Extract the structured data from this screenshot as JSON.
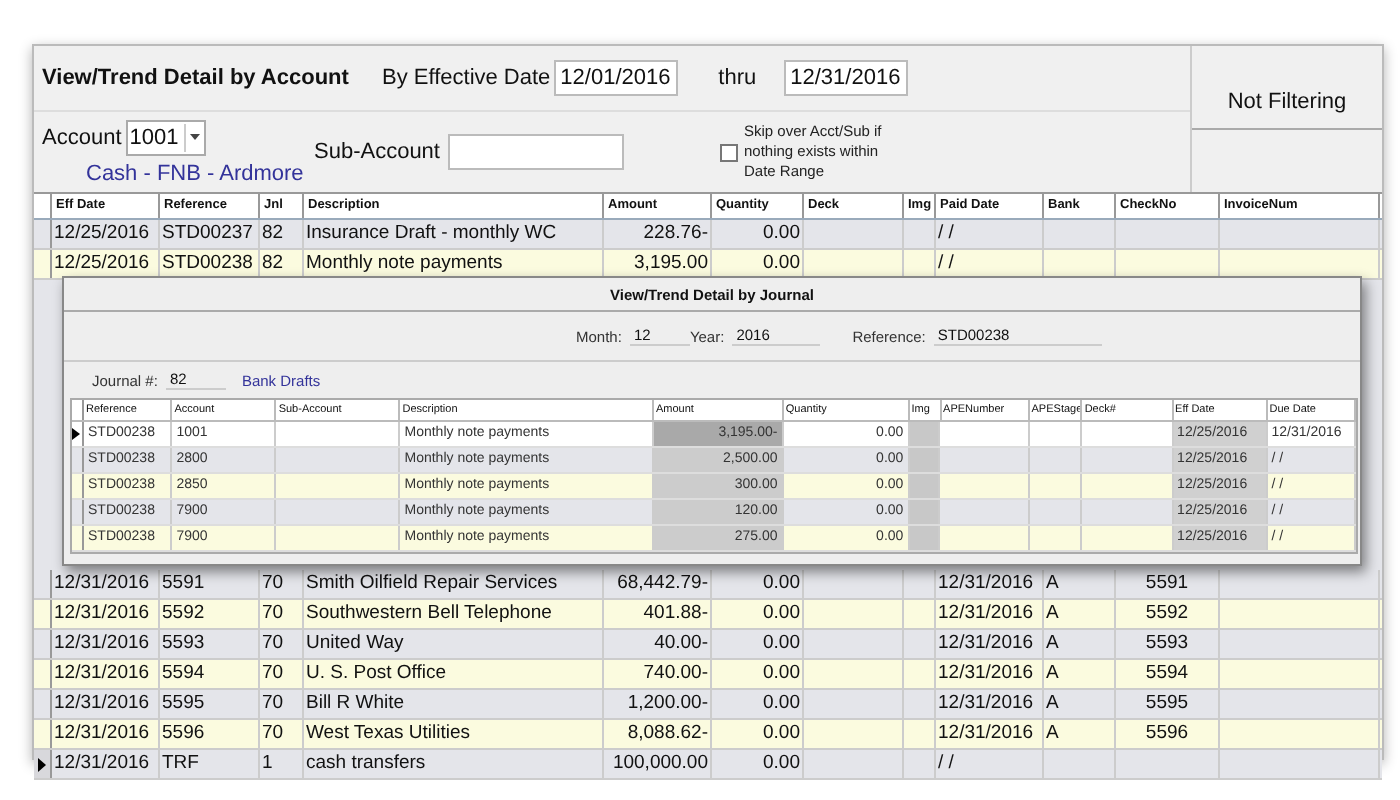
{
  "window": {
    "title": "View/Trend Detail by Account"
  },
  "filters": {
    "date_label": "By Effective Date",
    "date_from": "12/01/2016",
    "thru_label": "thru",
    "date_to": "12/31/2016",
    "account_label": "Account",
    "account": "1001",
    "account_name": "Cash - FNB - Ardmore",
    "subaccount_label": "Sub-Account",
    "skip_label": "Skip over Acct/Sub if nothing exists within Date Range",
    "skip_checked": false,
    "filter_status": "Not Filtering"
  },
  "table": {
    "columns": [
      "Eff Date",
      "Reference",
      "Jnl",
      "Description",
      "Amount",
      "Quantity",
      "Deck",
      "Img",
      "Paid Date",
      "Bank",
      "CheckNo",
      "InvoiceNum"
    ],
    "rows": [
      {
        "eff_date": "12/25/2016",
        "reference": "STD00237",
        "jnl": "82",
        "description": "Insurance Draft - monthly WC",
        "amount": "228.76-",
        "quantity": "0.00",
        "paid_date": "/ /",
        "current": false
      },
      {
        "eff_date": "12/25/2016",
        "reference": "STD00238",
        "jnl": "82",
        "description": "Monthly note payments",
        "amount": "3,195.00",
        "quantity": "0.00",
        "paid_date": "/ /",
        "current": false
      }
    ],
    "rows_below": [
      {
        "eff_date": "12/31/2016",
        "reference": "5591",
        "jnl": "70",
        "description": "Smith Oilfield Repair Services",
        "amount": "68,442.79-",
        "quantity": "0.00",
        "paid_date": "12/31/2016",
        "bank": "A",
        "checkno": "5591",
        "current": false
      },
      {
        "eff_date": "12/31/2016",
        "reference": "5592",
        "jnl": "70",
        "description": "Southwestern Bell Telephone",
        "amount": "401.88-",
        "quantity": "0.00",
        "paid_date": "12/31/2016",
        "bank": "A",
        "checkno": "5592",
        "current": false
      },
      {
        "eff_date": "12/31/2016",
        "reference": "5593",
        "jnl": "70",
        "description": "United Way",
        "amount": "40.00-",
        "quantity": "0.00",
        "paid_date": "12/31/2016",
        "bank": "A",
        "checkno": "5593",
        "current": false
      },
      {
        "eff_date": "12/31/2016",
        "reference": "5594",
        "jnl": "70",
        "description": "U. S. Post Office",
        "amount": "740.00-",
        "quantity": "0.00",
        "paid_date": "12/31/2016",
        "bank": "A",
        "checkno": "5594",
        "current": false
      },
      {
        "eff_date": "12/31/2016",
        "reference": "5595",
        "jnl": "70",
        "description": "Bill R White",
        "amount": "1,200.00-",
        "quantity": "0.00",
        "paid_date": "12/31/2016",
        "bank": "A",
        "checkno": "5595",
        "current": false
      },
      {
        "eff_date": "12/31/2016",
        "reference": "5596",
        "jnl": "70",
        "description": "West Texas Utilities",
        "amount": "8,088.62-",
        "quantity": "0.00",
        "paid_date": "12/31/2016",
        "bank": "A",
        "checkno": "5596",
        "current": false
      },
      {
        "eff_date": "12/31/2016",
        "reference": "TRF",
        "jnl": "1",
        "description": "cash transfers",
        "amount": "100,000.00",
        "quantity": "0.00",
        "paid_date": "/ /",
        "current": true
      }
    ]
  },
  "journal_dialog": {
    "title": "View/Trend Detail by Journal",
    "month_label": "Month:",
    "month": "12",
    "year_label": "Year:",
    "year": "2016",
    "reference_label": "Reference:",
    "reference": "STD00238",
    "journal_label": "Journal #:",
    "journal": "82",
    "journal_name": "Bank Drafts",
    "columns": [
      "Reference",
      "Account",
      "Sub-Account",
      "Description",
      "Amount",
      "Quantity",
      "Img",
      "APENumber",
      "APEStage",
      "Deck#",
      "Eff Date",
      "Due Date"
    ],
    "rows": [
      {
        "reference": "STD00238",
        "account": "1001",
        "description": "Monthly note payments",
        "amount": "3,195.00-",
        "quantity": "0.00",
        "eff_date": "12/25/2016",
        "due_date": "12/31/2016",
        "selected": true
      },
      {
        "reference": "STD00238",
        "account": "2800",
        "description": "Monthly note payments",
        "amount": "2,500.00",
        "quantity": "0.00",
        "eff_date": "12/25/2016",
        "due_date": "/ /",
        "selected": false
      },
      {
        "reference": "STD00238",
        "account": "2850",
        "description": "Monthly note payments",
        "amount": "300.00",
        "quantity": "0.00",
        "eff_date": "12/25/2016",
        "due_date": "/ /",
        "selected": false
      },
      {
        "reference": "STD00238",
        "account": "7900",
        "description": "Monthly note payments",
        "amount": "120.00",
        "quantity": "0.00",
        "eff_date": "12/25/2016",
        "due_date": "/ /",
        "selected": false
      },
      {
        "reference": "STD00238",
        "account": "7900",
        "description": "Monthly note payments",
        "amount": "275.00",
        "quantity": "0.00",
        "eff_date": "12/25/2016",
        "due_date": "/ /",
        "selected": false
      }
    ]
  }
}
